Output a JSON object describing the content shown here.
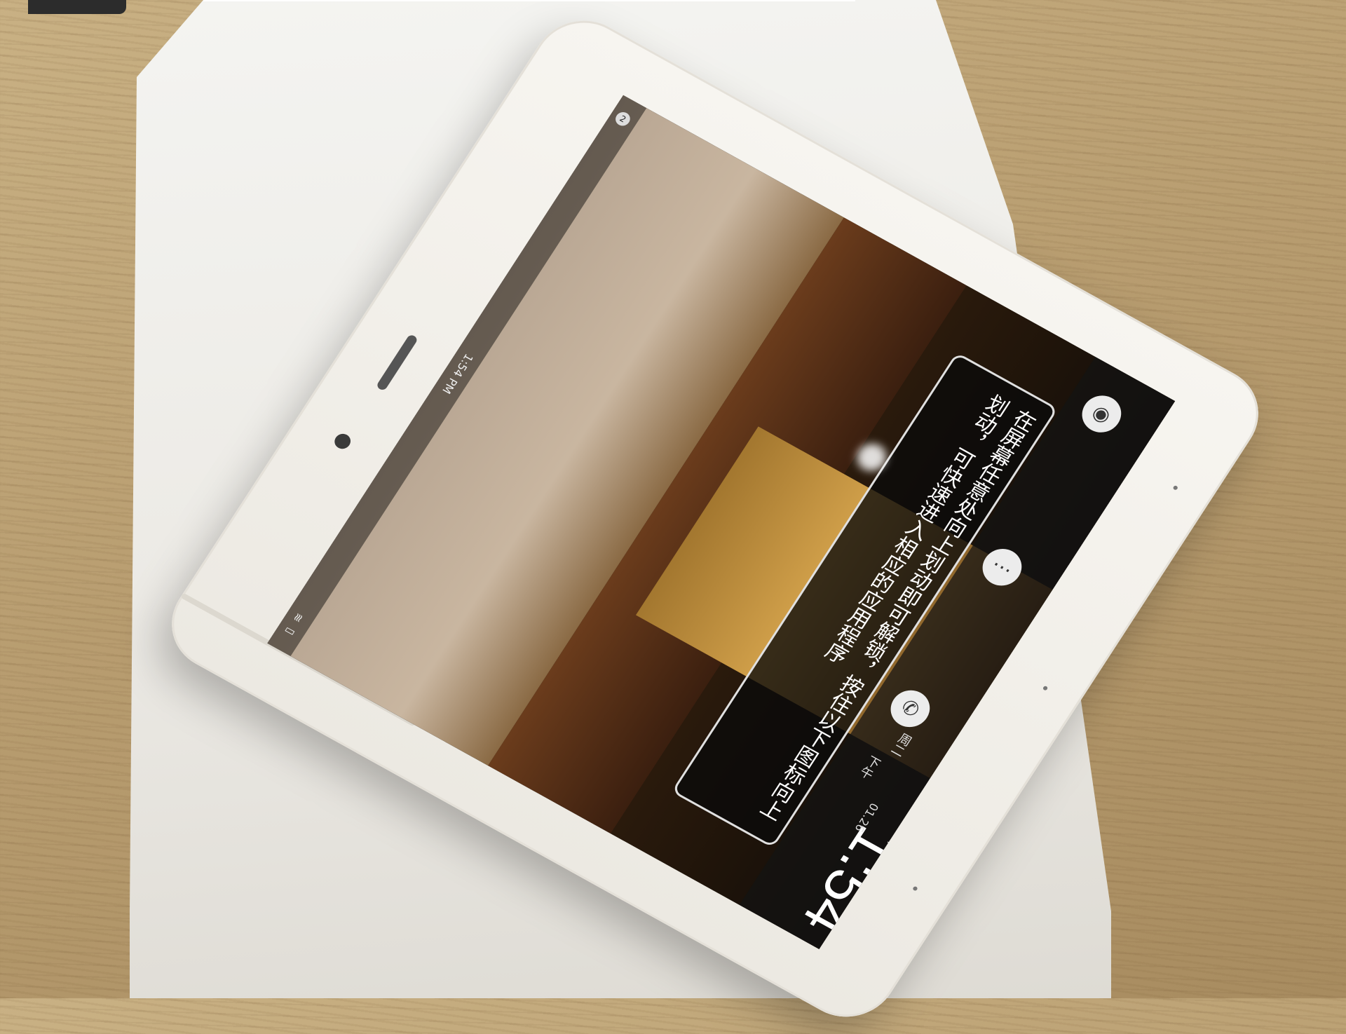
{
  "status_bar": {
    "time": "1:54 PM",
    "notification_badge": "2",
    "icons": [
      "wifi-icon",
      "battery-icon"
    ]
  },
  "lock_clock": {
    "time": "1:54",
    "ampm": "下午",
    "weekday": "周二",
    "date": "01.26"
  },
  "hint": {
    "text": "在屏幕任意处向上划动即可解锁，按住以下图标向上划动，可快速进入相应的应用程序"
  },
  "dock": {
    "icons": [
      "phone-icon",
      "message-icon",
      "camera-icon"
    ]
  }
}
